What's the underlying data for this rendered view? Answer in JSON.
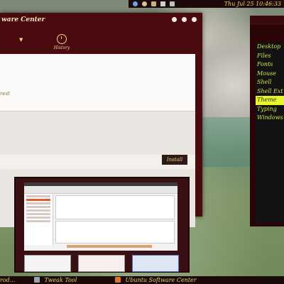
{
  "top_panel": {
    "clock": "Thu Jul 25  10:46:33"
  },
  "main_window": {
    "title": "ware Center",
    "toolbar": {
      "history_label": "History"
    },
    "card_text": "rest",
    "install_label": "Install"
  },
  "theme_panel": {
    "items": [
      "Desktop",
      "Files",
      "Fonts",
      "Mouse",
      "Shell",
      "Shell Ext",
      "Theme",
      "Typing",
      "Windows"
    ],
    "selected": "Theme"
  },
  "taskbar": {
    "items": [
      "rod...",
      "Tweak Tool",
      "Ubuntu Software Center"
    ]
  },
  "colors": {
    "window_bg": "#4b0a0e",
    "accent_text": "#e8d36a",
    "selected_item": "#e7f52a"
  }
}
